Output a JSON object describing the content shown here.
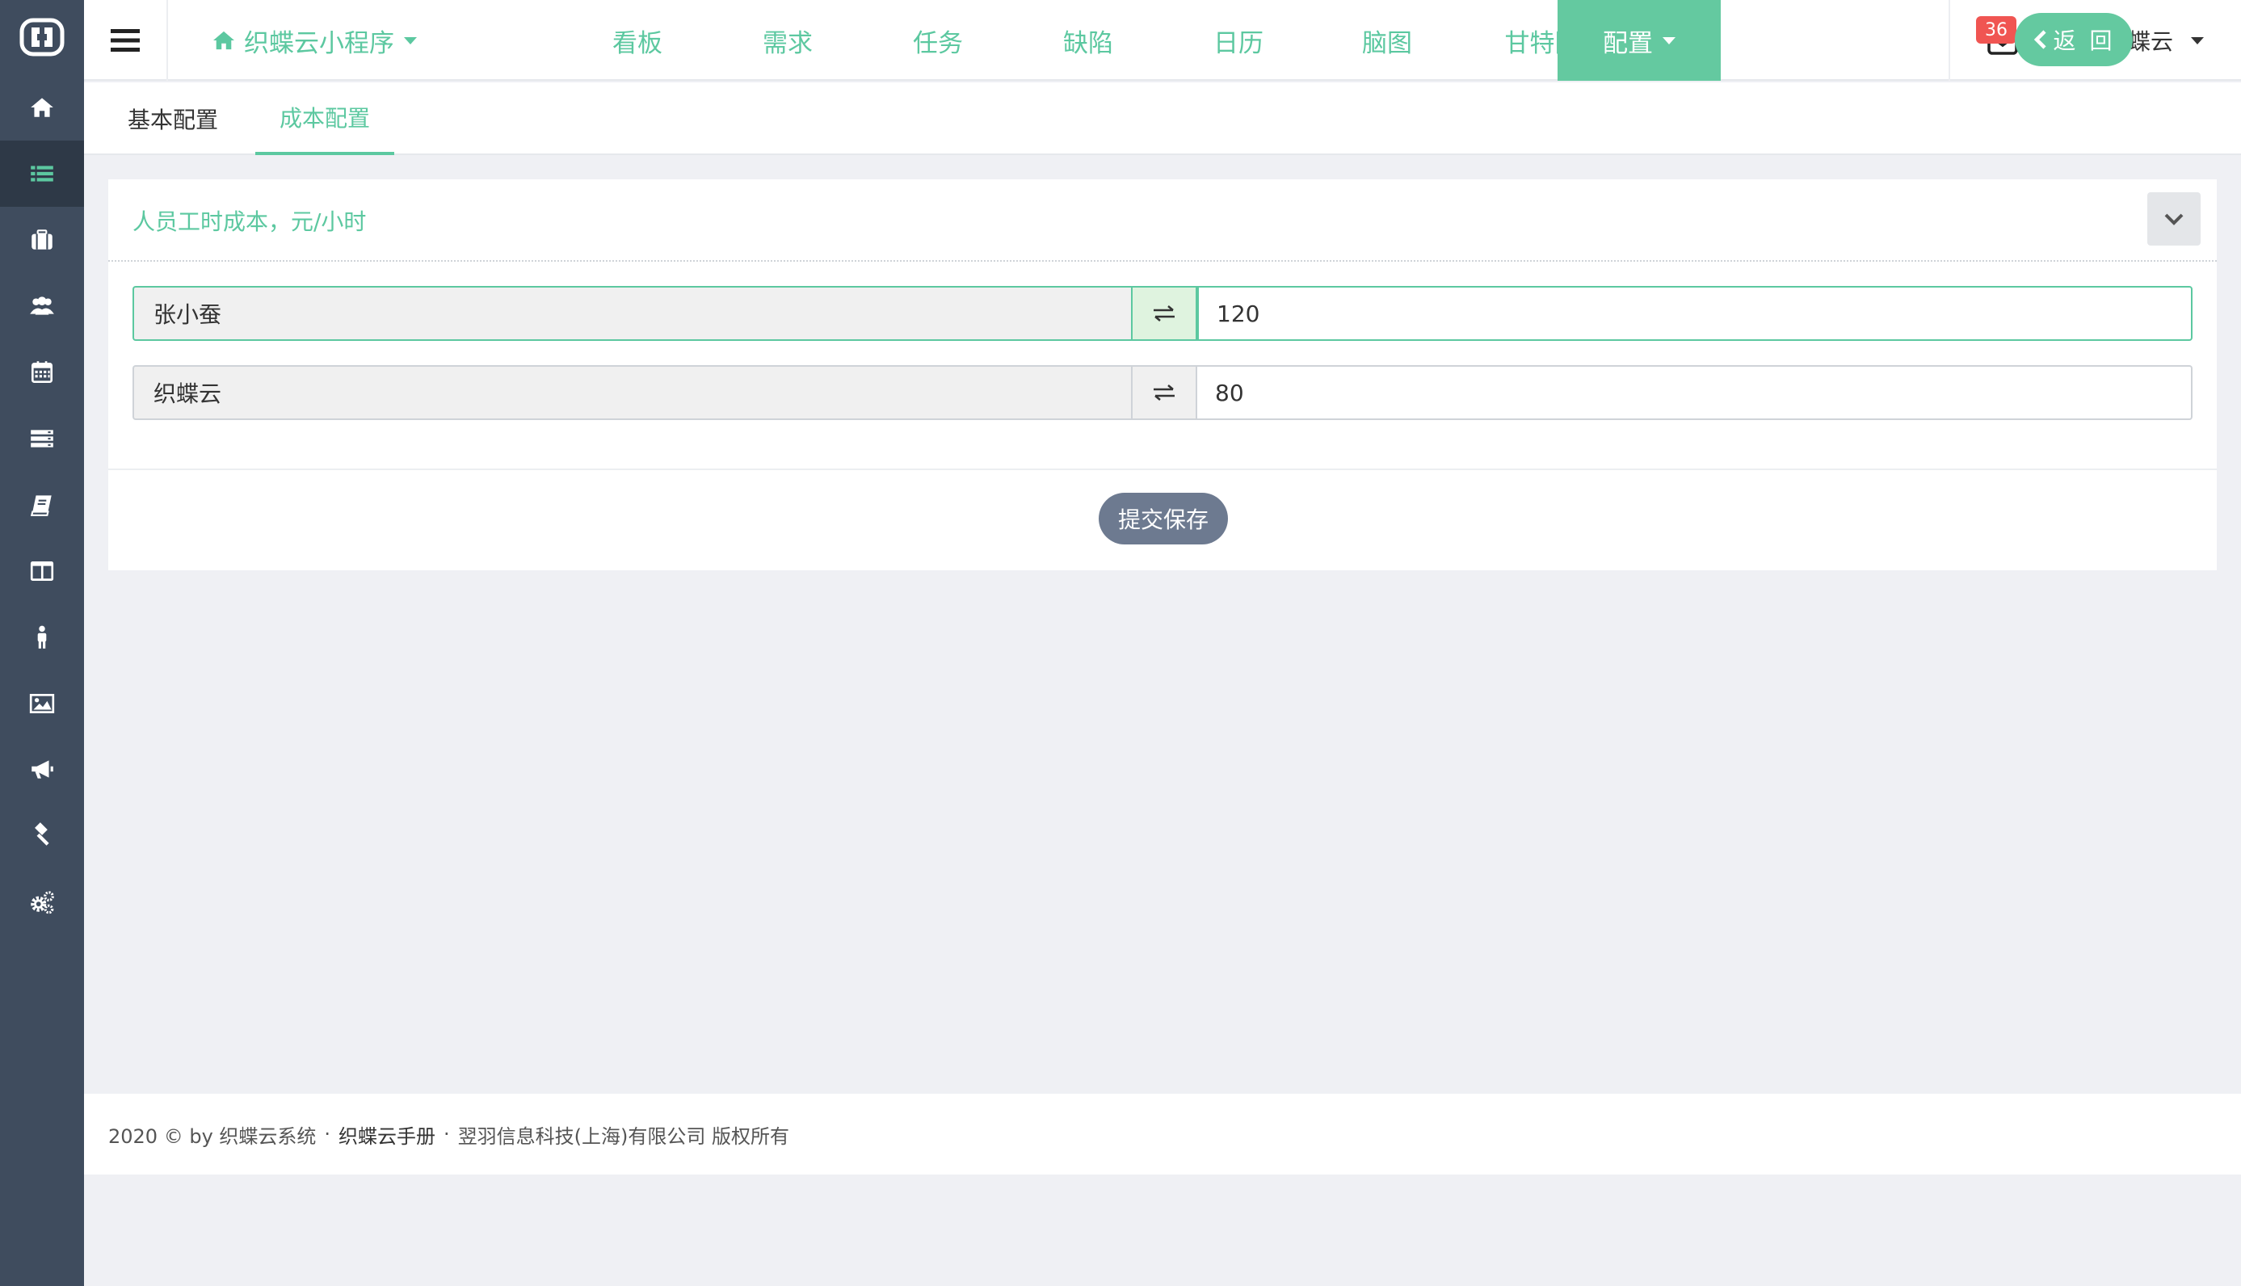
{
  "sidebar": {
    "logo_icon": "zhidie-logo-icon",
    "items": [
      {
        "icon": "home-icon"
      },
      {
        "icon": "list-icon",
        "active": true
      },
      {
        "icon": "briefcase-icon"
      },
      {
        "icon": "users-icon"
      },
      {
        "icon": "calendar-icon"
      },
      {
        "icon": "server-icon"
      },
      {
        "icon": "book-icon"
      },
      {
        "icon": "columns-icon"
      },
      {
        "icon": "person-icon"
      },
      {
        "icon": "image-icon"
      },
      {
        "icon": "bullhorn-icon"
      },
      {
        "icon": "gavel-icon"
      },
      {
        "icon": "gears-icon"
      }
    ]
  },
  "topnav": {
    "project": "织蝶云小程序",
    "items": [
      "看板",
      "需求",
      "任务",
      "缺陷",
      "日历",
      "脑图",
      "甘特图"
    ],
    "active": "配置",
    "mail_count": "36",
    "user_name": "织蝶云"
  },
  "subtabs": {
    "items": [
      "基本配置",
      "成本配置"
    ],
    "active_index": 1,
    "back_label": "返 回"
  },
  "panel": {
    "title": "人员工时成本，元/小时",
    "rows": [
      {
        "name": "张小蚕",
        "value": "120"
      },
      {
        "name": "织蝶云",
        "value": "80"
      }
    ],
    "submit_label": "提交保存"
  },
  "footer": {
    "copyright": "2020 © by 织蝶云系统",
    "sep": "·",
    "manual": "织蝶云手册",
    "company": "翌羽信息科技(上海)有限公司 版权所有"
  },
  "colors": {
    "accent": "#64c9a0",
    "sidebar": "#3f4c5e",
    "badge": "#f05552",
    "submit": "#6d7a90"
  }
}
